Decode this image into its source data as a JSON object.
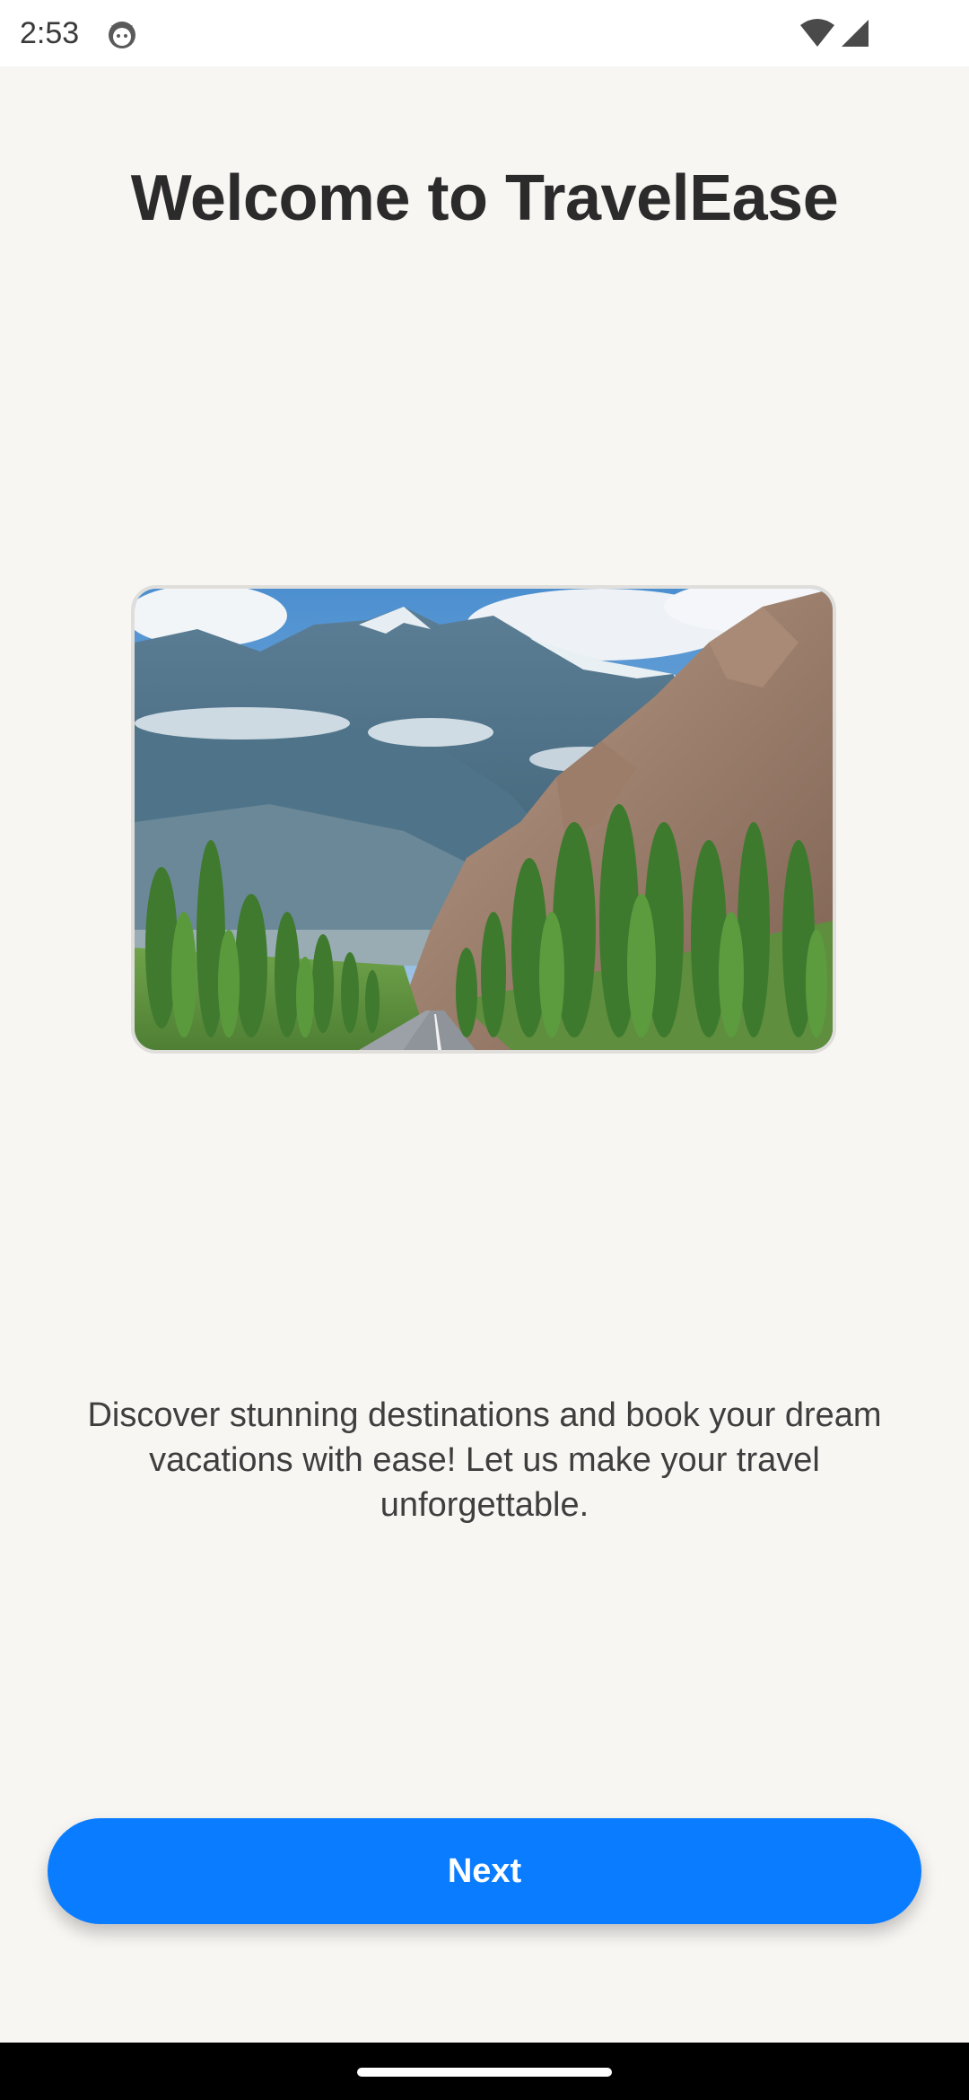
{
  "status_bar": {
    "time": "2:53",
    "icons": [
      "app-notification-icon",
      "wifi-icon",
      "cell-signal-icon"
    ]
  },
  "onboarding": {
    "title": "Welcome to TravelEase",
    "image": "mountain-road-landscape",
    "description": "Discover stunning destinations and book your dream vacations with ease! Let us make your travel unforgettable.",
    "next_label": "Next"
  },
  "colors": {
    "background": "#F8F6F3",
    "accent": "#0A7CFF",
    "title_text": "#2B2B2B",
    "body_text": "#3E3E3E"
  }
}
